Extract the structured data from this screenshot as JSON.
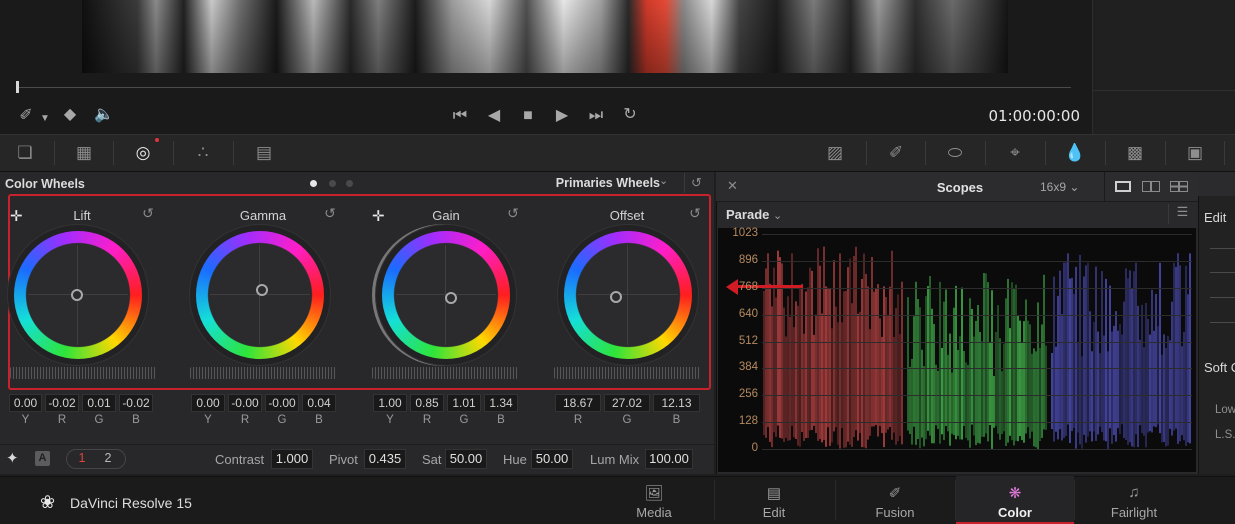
{
  "viewer": {
    "timecode": "01:00:00:00",
    "icons": [
      "eyedropper-icon",
      "layers-icon",
      "volume-icon",
      "skip-back-icon",
      "step-back-icon",
      "stop-icon",
      "play-icon",
      "skip-forward-icon",
      "loop-icon"
    ]
  },
  "toolbar": {
    "left_icons": [
      "3d-lut-icon",
      "selection-grid-icon",
      "color-wheels-icon",
      "rgb-mixer-icon",
      "motion-effects-icon"
    ],
    "right_icons": [
      "curves-icon",
      "qualifier-icon",
      "window-icon",
      "tracker-icon",
      "blur-icon",
      "key-icon",
      "sizing-icon"
    ]
  },
  "color_wheels": {
    "title": "Color Wheels",
    "mode": "Primaries Wheels",
    "wheels": [
      {
        "label": "Lift",
        "values": [
          "0.00",
          "-0.02",
          "0.01",
          "-0.02"
        ],
        "channels": [
          "Y",
          "R",
          "G",
          "B"
        ]
      },
      {
        "label": "Gamma",
        "values": [
          "0.00",
          "-0.00",
          "-0.00",
          "0.04"
        ],
        "channels": [
          "Y",
          "R",
          "G",
          "B"
        ]
      },
      {
        "label": "Gain",
        "values": [
          "1.00",
          "0.85",
          "1.01",
          "1.34"
        ],
        "channels": [
          "Y",
          "R",
          "G",
          "B"
        ]
      },
      {
        "label": "Offset",
        "values": [
          "18.67",
          "27.02",
          "12.13"
        ],
        "channels": [
          "R",
          "G",
          "B"
        ]
      }
    ]
  },
  "adjustments": {
    "page_tabs": [
      "1",
      "2"
    ],
    "auto_badge": "A",
    "contrast": {
      "label": "Contrast",
      "value": "1.000"
    },
    "pivot": {
      "label": "Pivot",
      "value": "0.435"
    },
    "sat": {
      "label": "Sat",
      "value": "50.00"
    },
    "hue": {
      "label": "Hue",
      "value": "50.00"
    },
    "lum_mix": {
      "label": "Lum Mix",
      "value": "100.00"
    }
  },
  "scopes": {
    "title": "Scopes",
    "aspect": "16x9",
    "mode": "Parade",
    "ticks": [
      "1023",
      "896",
      "768",
      "640",
      "512",
      "384",
      "256",
      "128",
      "0"
    ],
    "colors": {
      "red": "#ff5a5a",
      "green": "#5cff6a",
      "blue": "#6a6aff",
      "tick": "#b58a5f",
      "highlight": "#c8232c"
    }
  },
  "right_panel": {
    "edit": "Edit",
    "soft": "Soft C",
    "low": "Low",
    "ls": "L.S."
  },
  "bottom_nav": {
    "brand": "DaVinci Resolve 15",
    "tabs": [
      {
        "label": "Media",
        "icon": "media-icon"
      },
      {
        "label": "Edit",
        "icon": "edit-icon"
      },
      {
        "label": "Fusion",
        "icon": "fusion-icon"
      },
      {
        "label": "Color",
        "icon": "color-icon",
        "active": true
      },
      {
        "label": "Fairlight",
        "icon": "fairlight-icon"
      }
    ]
  }
}
